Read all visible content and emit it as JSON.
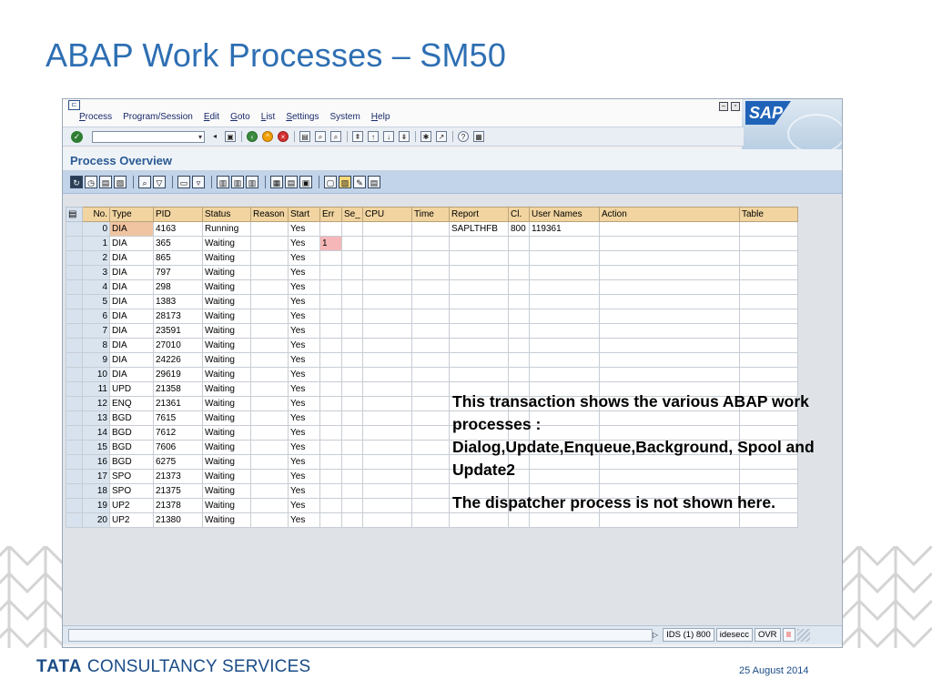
{
  "slide": {
    "title": "ABAP Work Processes – SM50",
    "annotation": [
      "This transaction shows the various ABAP work processes : Dialog,Update,Enqueue,Background, Spool and Update2",
      "The dispatcher process is not shown here."
    ],
    "footer_company_tata": "TATA",
    "footer_company_rest": " CONSULTANCY SERVICES",
    "footer_date": "25 August 2014"
  },
  "sap": {
    "menu": [
      {
        "u": "P",
        "rest": "rocess"
      },
      {
        "u": "",
        "rest": "Program/Session"
      },
      {
        "u": "E",
        "rest": "dit"
      },
      {
        "u": "G",
        "rest": "oto"
      },
      {
        "u": "L",
        "rest": "ist"
      },
      {
        "u": "S",
        "rest": "ettings"
      },
      {
        "u": "",
        "rest": "System"
      },
      {
        "u": "H",
        "rest": "elp"
      }
    ],
    "logo_text": "SAP",
    "command_field_value": "",
    "screen_title": "Process Overview",
    "grid": {
      "columns": [
        "No.",
        "Type",
        "PID",
        "Status",
        "Reason",
        "Start",
        "Err",
        "Se_",
        "CPU",
        "Time",
        "Report",
        "Cl.",
        "User Names",
        "Action",
        "Table"
      ],
      "rows": [
        [
          "0",
          "DIA",
          "4163",
          "Running",
          "",
          "Yes",
          "",
          "",
          "",
          "",
          "SAPLTHFB",
          "800",
          "119361",
          "",
          ""
        ],
        [
          "1",
          "DIA",
          "365",
          "Waiting",
          "",
          "Yes",
          "1",
          "",
          "",
          "",
          "",
          "",
          "",
          "",
          ""
        ],
        [
          "2",
          "DIA",
          "865",
          "Waiting",
          "",
          "Yes",
          "",
          "",
          "",
          "",
          "",
          "",
          "",
          "",
          ""
        ],
        [
          "3",
          "DIA",
          "797",
          "Waiting",
          "",
          "Yes",
          "",
          "",
          "",
          "",
          "",
          "",
          "",
          "",
          ""
        ],
        [
          "4",
          "DIA",
          "298",
          "Waiting",
          "",
          "Yes",
          "",
          "",
          "",
          "",
          "",
          "",
          "",
          "",
          ""
        ],
        [
          "5",
          "DIA",
          "1383",
          "Waiting",
          "",
          "Yes",
          "",
          "",
          "",
          "",
          "",
          "",
          "",
          "",
          ""
        ],
        [
          "6",
          "DIA",
          "28173",
          "Waiting",
          "",
          "Yes",
          "",
          "",
          "",
          "",
          "",
          "",
          "",
          "",
          ""
        ],
        [
          "7",
          "DIA",
          "23591",
          "Waiting",
          "",
          "Yes",
          "",
          "",
          "",
          "",
          "",
          "",
          "",
          "",
          ""
        ],
        [
          "8",
          "DIA",
          "27010",
          "Waiting",
          "",
          "Yes",
          "",
          "",
          "",
          "",
          "",
          "",
          "",
          "",
          ""
        ],
        [
          "9",
          "DIA",
          "24226",
          "Waiting",
          "",
          "Yes",
          "",
          "",
          "",
          "",
          "",
          "",
          "",
          "",
          ""
        ],
        [
          "10",
          "DIA",
          "29619",
          "Waiting",
          "",
          "Yes",
          "",
          "",
          "",
          "",
          "",
          "",
          "",
          "",
          ""
        ],
        [
          "11",
          "UPD",
          "21358",
          "Waiting",
          "",
          "Yes",
          "",
          "",
          "",
          "",
          "",
          "",
          "",
          "",
          ""
        ],
        [
          "12",
          "ENQ",
          "21361",
          "Waiting",
          "",
          "Yes",
          "",
          "",
          "",
          "",
          "",
          "",
          "",
          "",
          ""
        ],
        [
          "13",
          "BGD",
          "7615",
          "Waiting",
          "",
          "Yes",
          "",
          "",
          "",
          "",
          "",
          "",
          "",
          "",
          ""
        ],
        [
          "14",
          "BGD",
          "7612",
          "Waiting",
          "",
          "Yes",
          "",
          "",
          "",
          "",
          "",
          "",
          "",
          "",
          ""
        ],
        [
          "15",
          "BGD",
          "7606",
          "Waiting",
          "",
          "Yes",
          "",
          "",
          "",
          "",
          "",
          "",
          "",
          "",
          ""
        ],
        [
          "16",
          "BGD",
          "6275",
          "Waiting",
          "",
          "Yes",
          "",
          "",
          "",
          "",
          "",
          "",
          "",
          "",
          ""
        ],
        [
          "17",
          "SPO",
          "21373",
          "Waiting",
          "",
          "Yes",
          "",
          "",
          "",
          "",
          "",
          "",
          "",
          "",
          ""
        ],
        [
          "18",
          "SPO",
          "21375",
          "Waiting",
          "",
          "Yes",
          "",
          "",
          "",
          "",
          "",
          "",
          "",
          "",
          ""
        ],
        [
          "19",
          "UP2",
          "21378",
          "Waiting",
          "",
          "Yes",
          "",
          "",
          "",
          "",
          "",
          "",
          "",
          "",
          ""
        ],
        [
          "20",
          "UP2",
          "21380",
          "Waiting",
          "",
          "Yes",
          "",
          "",
          "",
          "",
          "",
          "",
          "",
          "",
          ""
        ]
      ]
    },
    "status": {
      "system": "IDS (1) 800",
      "host": "idesecc",
      "mode": "OVR"
    }
  },
  "colors": {
    "title_blue": "#2e6fb3",
    "app_toolbar": "#c2d4ea",
    "header_orange": "#f1d4a0",
    "err_pink": "#f5b7b7"
  }
}
